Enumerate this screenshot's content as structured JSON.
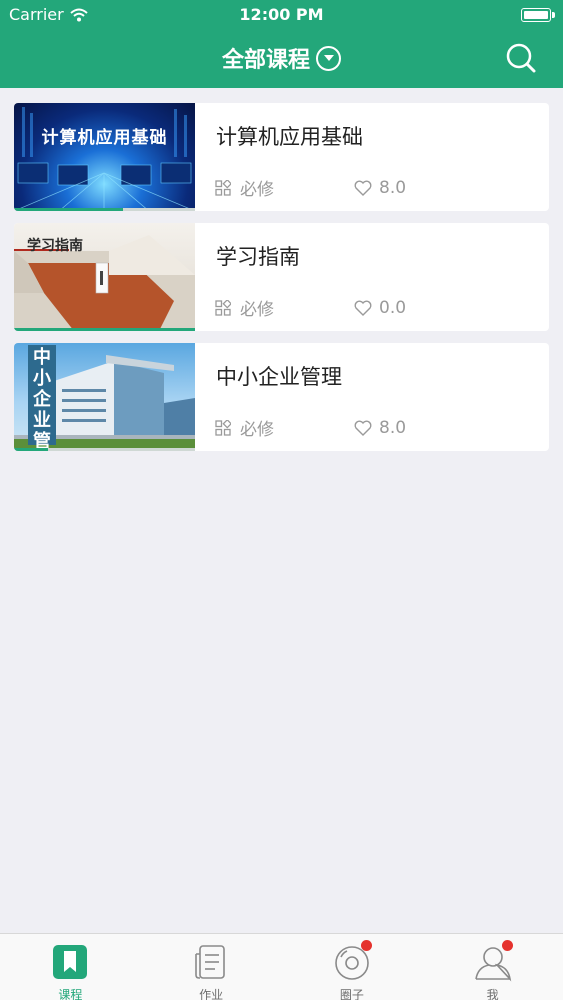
{
  "status_bar": {
    "carrier": "Carrier",
    "time": "12:00 PM"
  },
  "nav": {
    "title": "全部课程",
    "dropdown_icon": "chevron-down-circle-icon",
    "search_icon": "search-icon"
  },
  "courses": [
    {
      "title": "计算机应用基础",
      "thumbnail_caption": "计算机应用基础",
      "type_label": "必修",
      "rating": "8.0",
      "progress": 0.6
    },
    {
      "title": "学习指南",
      "thumbnail_caption": "学习指南",
      "type_label": "必修",
      "rating": "0.0",
      "progress": 1.0
    },
    {
      "title": "中小企业管理",
      "thumbnail_caption": "中小企业管理",
      "type_label": "必修",
      "rating": "8.0",
      "progress": 0.19
    }
  ],
  "tabs": [
    {
      "label": "课程",
      "icon": "bookmark-icon",
      "active": true,
      "badge": false
    },
    {
      "label": "作业",
      "icon": "document-icon",
      "active": false,
      "badge": false
    },
    {
      "label": "圈子",
      "icon": "disc-icon",
      "active": false,
      "badge": true
    },
    {
      "label": "我",
      "icon": "user-icon",
      "active": false,
      "badge": true
    }
  ],
  "colors": {
    "brand": "#23a77a",
    "background": "#efeff4",
    "badge": "#e5322d"
  }
}
